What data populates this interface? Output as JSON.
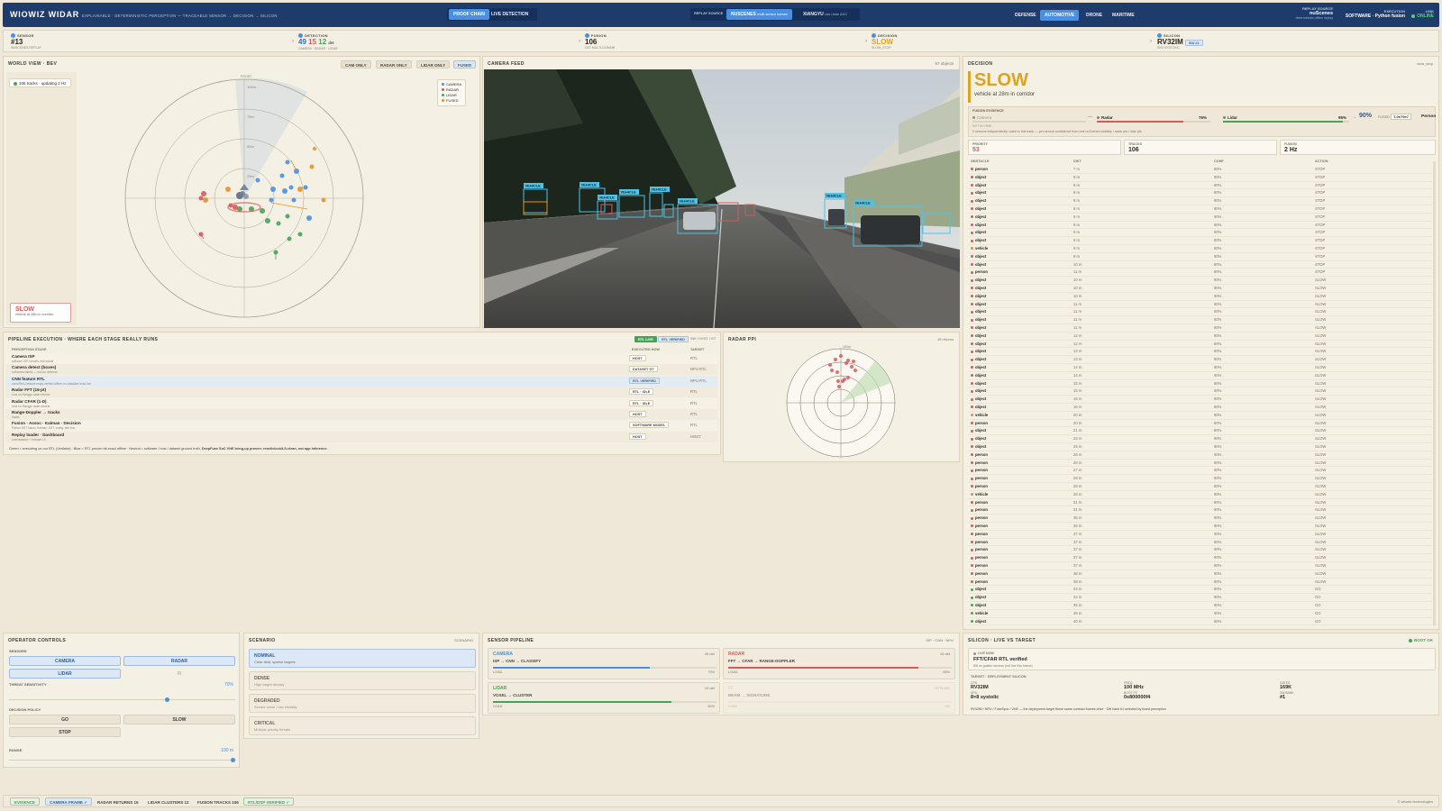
{
  "topbar": {
    "brand": "WIOWIZ WIDAR",
    "tagline": "EXPLAINABLE · DETERMINISTIC PERCEPTION — TRACEABLE SENSOR → DECISION → SILICON",
    "modes": [
      "PROOF CHAIN",
      "LIVE DETECTION"
    ],
    "replay_label": "REPLAY SOURCE",
    "replay_sources": [
      {
        "name": "NUSCENES",
        "sub": "multi-sensor scenes"
      },
      {
        "name": "XIANGYU",
        "sub": "raw radar ADC"
      }
    ],
    "domains": [
      "DEFENSE",
      "AUTOMOTIVE",
      "DRONE",
      "MARITIME"
    ],
    "replay_source_title": "REPLAY SOURCE",
    "replay_source_value": "nuScenes",
    "replay_source_sub": "deterministic offline replay",
    "execution_title": "EXECUTION",
    "execution_value": "SOFTWARE · Python fusion",
    "link_title": "LINK",
    "link_value": "ONLINE"
  },
  "stages": [
    {
      "label": "SENSOR",
      "value": "#13",
      "sub": "NUSCENES REPLAY"
    },
    {
      "label": "DETECTION",
      "value": "",
      "counts": [
        "49",
        "15",
        "12"
      ],
      "unit": "det",
      "sub": "CAMERA · RADAR · LIDAR"
    },
    {
      "label": "FUSION",
      "value": "106",
      "sub": "DST MULTI-DOMAIN"
    },
    {
      "label": "DECISION",
      "value": "SLOW",
      "sub": "SLOW_STOP"
    },
    {
      "label": "SILICON",
      "value": "RV32IM",
      "badge": "SIU #1",
      "sub": "RISI SYSTOLIC"
    }
  ],
  "world": {
    "title": "WORLD VIEW · BEV",
    "views": [
      "CAM ONLY",
      "RADAR ONLY",
      "LIDAR ONLY",
      "FUSED"
    ],
    "status": "106 tracks · updating 2 Hz",
    "front_label": "FRONT",
    "ring_labels": [
      "100m",
      "75m",
      "50m",
      "25m"
    ],
    "legend": [
      "CAMERA",
      "RADAR",
      "LIDAR",
      "FUSED"
    ],
    "decision": "SLOW",
    "decision_sub": "vehicle at 28m in corridor"
  },
  "camera": {
    "title": "CAMERA FEED",
    "count": "67 objects",
    "box_label": "VEHICLE"
  },
  "decision": {
    "title": "DECISION",
    "tag": "slow_stop",
    "value": "SLOW",
    "reason": "vehicle at 28m in corridor",
    "evidence_title": "FUSION EVIDENCE",
    "camera_label": "Camera",
    "radar_label": "Radar",
    "radar_pct": "76%",
    "lidar_label": "Lidar",
    "lidar_pct": "95%",
    "fused_pct": "90%",
    "fused_label": "FUSED",
    "track_id": "T-0e79e7",
    "class": "Person",
    "not_in_view": "NOT IN VIEW",
    "note": "2 sensors independently voted to this track — per-sensor confidence from real nuScenes visibility / radar pts / lidar pts",
    "priority_label": "PRIORITY",
    "priority": "53",
    "tracks_label": "TRACKS",
    "tracks": "106",
    "fusion_label": "FUSION",
    "fusion": "2 Hz",
    "table_headers": [
      "OBSTACLE",
      "DIST",
      "CONF",
      "ACTION"
    ],
    "rows": [
      [
        "person",
        "7 m",
        "90%",
        "STOP"
      ],
      [
        "object",
        "8 m",
        "90%",
        "STOP"
      ],
      [
        "object",
        "8 m",
        "90%",
        "STOP"
      ],
      [
        "object",
        "8 m",
        "90%",
        "STOP"
      ],
      [
        "object",
        "8 m",
        "90%",
        "STOP"
      ],
      [
        "object",
        "8 m",
        "90%",
        "STOP"
      ],
      [
        "object",
        "9 m",
        "90%",
        "STOP"
      ],
      [
        "object",
        "9 m",
        "90%",
        "STOP"
      ],
      [
        "object",
        "9 m",
        "90%",
        "STOP"
      ],
      [
        "object",
        "9 m",
        "90%",
        "STOP"
      ],
      [
        "vehicle",
        "9 m",
        "90%",
        "STOP"
      ],
      [
        "object",
        "9 m",
        "90%",
        "STOP"
      ],
      [
        "object",
        "10 m",
        "90%",
        "STOP"
      ],
      [
        "person",
        "11 m",
        "90%",
        "STOP"
      ],
      [
        "object",
        "10 m",
        "90%",
        "SLOW"
      ],
      [
        "object",
        "10 m",
        "90%",
        "SLOW"
      ],
      [
        "object",
        "10 m",
        "90%",
        "SLOW"
      ],
      [
        "object",
        "11 m",
        "90%",
        "SLOW"
      ],
      [
        "object",
        "11 m",
        "90%",
        "SLOW"
      ],
      [
        "object",
        "11 m",
        "90%",
        "SLOW"
      ],
      [
        "object",
        "11 m",
        "90%",
        "SLOW"
      ],
      [
        "object",
        "12 m",
        "90%",
        "SLOW"
      ],
      [
        "object",
        "12 m",
        "90%",
        "SLOW"
      ],
      [
        "object",
        "13 m",
        "90%",
        "SLOW"
      ],
      [
        "object",
        "13 m",
        "90%",
        "SLOW"
      ],
      [
        "object",
        "14 m",
        "90%",
        "SLOW"
      ],
      [
        "object",
        "14 m",
        "90%",
        "SLOW"
      ],
      [
        "object",
        "15 m",
        "90%",
        "SLOW"
      ],
      [
        "object",
        "15 m",
        "90%",
        "SLOW"
      ],
      [
        "object",
        "16 m",
        "90%",
        "SLOW"
      ],
      [
        "object",
        "16 m",
        "90%",
        "SLOW"
      ],
      [
        "vehicle",
        "20 m",
        "90%",
        "SLOW"
      ],
      [
        "person",
        "20 m",
        "90%",
        "SLOW"
      ],
      [
        "object",
        "21 m",
        "90%",
        "SLOW"
      ],
      [
        "object",
        "23 m",
        "90%",
        "SLOW"
      ],
      [
        "object",
        "25 m",
        "90%",
        "SLOW"
      ],
      [
        "person",
        "26 m",
        "90%",
        "SLOW"
      ],
      [
        "person",
        "26 m",
        "90%",
        "SLOW"
      ],
      [
        "person",
        "27 m",
        "90%",
        "SLOW"
      ],
      [
        "person",
        "28 m",
        "90%",
        "SLOW"
      ],
      [
        "person",
        "28 m",
        "90%",
        "SLOW"
      ],
      [
        "vehicle",
        "28 m",
        "90%",
        "SLOW"
      ],
      [
        "person",
        "31 m",
        "90%",
        "SLOW"
      ],
      [
        "person",
        "31 m",
        "90%",
        "SLOW"
      ],
      [
        "person",
        "35 m",
        "90%",
        "SLOW"
      ],
      [
        "person",
        "36 m",
        "90%",
        "SLOW"
      ],
      [
        "person",
        "37 m",
        "90%",
        "SLOW"
      ],
      [
        "person",
        "37 m",
        "90%",
        "SLOW"
      ],
      [
        "person",
        "37 m",
        "90%",
        "SLOW"
      ],
      [
        "person",
        "37 m",
        "90%",
        "SLOW"
      ],
      [
        "person",
        "37 m",
        "90%",
        "SLOW"
      ],
      [
        "person",
        "38 m",
        "90%",
        "SLOW"
      ],
      [
        "person",
        "38 m",
        "90%",
        "SLOW"
      ],
      [
        "object",
        "34 m",
        "90%",
        "GO"
      ],
      [
        "object",
        "34 m",
        "90%",
        "GO"
      ],
      [
        "object",
        "35 m",
        "90%",
        "GO"
      ],
      [
        "vehicle",
        "36 m",
        "90%",
        "GO"
      ],
      [
        "object",
        "40 m",
        "90%",
        "GO"
      ]
    ]
  },
  "pipeline": {
    "title": "PIPELINE EXECUTION · WHERE EACH STAGE REALLY RUNS",
    "legend": [
      "RTL LIVE",
      "RTL VERIFIED",
      "SW / HOST / GT"
    ],
    "headers": [
      "PERCEPTION STAGE",
      "EXECUTED NOW",
      "TARGET"
    ],
    "rows": [
      {
        "name": "Camera ISP",
        "sub": "software ISP, kernels, real actual",
        "exec": "HOST",
        "target": "RTL"
      },
      {
        "name": "Camera detect (boxes)",
        "sub": "nuScenes labels — not our detector",
        "exec": "DATASET GT",
        "target": "NPU RTL"
      },
      {
        "name": "CNN feature RTL",
        "sub": "conv/ReLU feature maps verified offline; no classifier head live",
        "exec": "RTL VERIFIED",
        "target": "NPU RTL"
      },
      {
        "name": "Radar FFT (16-pt)",
        "sub": "runs on Xiangyu radar returns",
        "exec": "RTL · IDLE",
        "target": "RTL"
      },
      {
        "name": "Radar CFAR (1-D)",
        "sub": "runs on Xiangyu radar returns",
        "exec": "RTL · IDLE",
        "target": "RTL"
      },
      {
        "name": "Range-Doppler → tracks",
        "sub": "tracks",
        "exec": "HOST",
        "target": "RTL"
      },
      {
        "name": "Fusion · Assoc · Kalman · Decision",
        "sub": "Python DST fusion, Kalman, DST, voting, tied bus",
        "exec": "SOFTWARE MODEL",
        "target": "RTL"
      },
      {
        "name": "Replay loader · Dashboard",
        "sub": "orchestration + browser UI",
        "exec": "HOST",
        "target": "HOST"
      }
    ],
    "footer": "Green = executing on our RTL (Verilator) · Blue = RTL proven bit-exact offline · Neutral = software / host / dataset ground truth.",
    "footer_bold": "DeepFuse SoC VHE bring-up proven: reset/clock/LS-clean, not app inference."
  },
  "radar": {
    "title": "RADAR PPI",
    "count": "15 returns",
    "range": "100m"
  },
  "controls": {
    "title": "OPERATOR CONTROLS",
    "sensors_label": "SENSORS",
    "sensors": [
      "CAMERA",
      "RADAR",
      "LIDAR",
      "IR"
    ],
    "threat_label": "THREAT SENSITIVITY",
    "threat_value": "70%",
    "threat_level": 0.7,
    "policy_label": "DECISION POLICY",
    "policies": [
      "GO",
      "SLOW",
      "STOP"
    ],
    "range_label": "RANGE",
    "range_value": "100 m",
    "range_level": 1.0
  },
  "scenario": {
    "title": "SCENARIO",
    "tag": "SCENARIO",
    "items": [
      {
        "name": "NOMINAL",
        "sub": "Clear field, sparse targets"
      },
      {
        "name": "DENSE",
        "sub": "High target density"
      },
      {
        "name": "DEGRADED",
        "sub": "Sensor noise / low visibility"
      },
      {
        "name": "CRITICAL",
        "sub": "Multiple priority threats"
      }
    ]
  },
  "sensor_pipeline": {
    "title": "SENSOR PIPELINE",
    "tag": "ISP · CNN · NPU",
    "cards": [
      {
        "name": "CAMERA",
        "count": "49 det",
        "chain": "ISP → CNN → CLASSIFY",
        "load_label": "LOAD",
        "load": "70%",
        "level": 0.7,
        "color": "#4b8fe2"
      },
      {
        "name": "RADAR",
        "count": "15 det",
        "chain": "FFT → CFAR → RANGE-DOPPLER",
        "load_label": "LOAD",
        "load": "85%",
        "level": 0.85,
        "color": "#d65a5a"
      },
      {
        "name": "LIDAR",
        "count": "12 det",
        "chain": "VOXEL → CLUSTER",
        "load_label": "LOAD",
        "load": "80%",
        "level": 0.8,
        "color": "#46a259"
      },
      {
        "name": "IR",
        "count": "OFFLINE",
        "chain": "BEAM → SIGNATURE",
        "load_label": "LOAD",
        "load": "0%",
        "level": 0,
        "color": "#c9c1ae"
      }
    ]
  },
  "silicon": {
    "title": "SILICON · LIVE VS TARGET",
    "boot": "BOOT OK",
    "live_label": "LIVE NOW",
    "live_title": "FFT/CFAR RTL verified",
    "live_sub": "8/8 vs golden vectors (not live this frame)",
    "target_label": "TARGET · DEPLOYMENT SILICON",
    "cpu_label": "CPU",
    "cpu": "RV32IM",
    "freq_label": "FREQ",
    "freq": "100 MHz",
    "gates_label": "GATES",
    "gates": "169K",
    "npu_label": "NPU",
    "npu": "8×8 systolic",
    "boot_pc_label": "BOOT PC",
    "boot_pc": "0x800000f4",
    "sw_bank_label": "SW BANK",
    "sw_bank": "#1",
    "note": "RV32IM / NPU / FuseSync / VHE — the deployment target these same contract frames drive · SW bank #1 selected by fused perception"
  },
  "footer": {
    "chips": [
      "EVIDENCE",
      "CAMERA FRAME ✓",
      "RADAR RETURNS 15",
      "LIDAR CLUSTERS 12",
      "FUSION TRACKS 106",
      "RTL/DSP VERIFIED ✓"
    ],
    "copyright": "© wiowiz technologies"
  },
  "colors": {
    "camera": "#4b8fe2",
    "radar": "#d65a5a",
    "lidar": "#46a259",
    "fused": "#e0932c",
    "slow": "#d9a324"
  }
}
